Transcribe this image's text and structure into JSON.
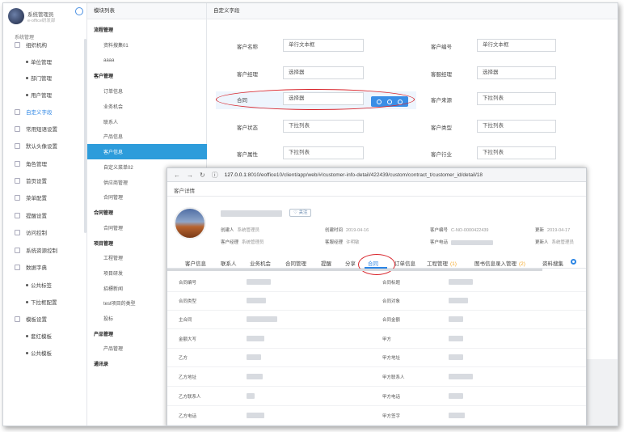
{
  "sidebar": {
    "user_name": "系统管理员",
    "user_sub": "e-office研发部",
    "section": "系统管理",
    "items": [
      {
        "label": "组织机构",
        "icon": "org-icon"
      },
      {
        "label": "单位管理",
        "sub": true
      },
      {
        "label": "部门管理",
        "sub": true
      },
      {
        "label": "用户管理",
        "sub": true
      },
      {
        "label": "自定义字段",
        "icon": "custom-field-icon",
        "active": true
      },
      {
        "label": "常用短语设置",
        "icon": "phrase-icon"
      },
      {
        "label": "默认头像设置",
        "icon": "avatar-setting-icon"
      },
      {
        "label": "角色管理",
        "icon": "role-icon"
      },
      {
        "label": "首页设置",
        "icon": "home-setting-icon"
      },
      {
        "label": "菜单配置",
        "icon": "menu-config-icon"
      },
      {
        "label": "提醒设置",
        "icon": "reminder-icon"
      },
      {
        "label": "访问控制",
        "icon": "access-icon"
      },
      {
        "label": "系统资源控制",
        "icon": "resource-icon"
      },
      {
        "label": "数据字典",
        "icon": "dictionary-icon"
      },
      {
        "label": "公共标签",
        "sub": true
      },
      {
        "label": "下拉框配置",
        "sub": true
      },
      {
        "label": "模板设置",
        "icon": "template-icon"
      },
      {
        "label": "套红模板",
        "sub": true
      },
      {
        "label": "公共模板",
        "sub": true
      }
    ]
  },
  "modules": {
    "title": "模块列表",
    "rows": [
      {
        "label": "流程管理",
        "group": true
      },
      {
        "label": "资料搜集01"
      },
      {
        "label": "aaaa"
      },
      {
        "label": "客户管理",
        "group": true
      },
      {
        "label": "订单信息"
      },
      {
        "label": "业务机会"
      },
      {
        "label": "联系人"
      },
      {
        "label": "产品信息"
      },
      {
        "label": "客户信息",
        "selected": true
      },
      {
        "label": "自定义菜单02"
      },
      {
        "label": "供应商管理"
      },
      {
        "label": "合同管理"
      },
      {
        "label": "合同管理",
        "group": true
      },
      {
        "label": "合同管理"
      },
      {
        "label": "项目管理",
        "group": true
      },
      {
        "label": "工程管理"
      },
      {
        "label": "项目研发"
      },
      {
        "label": "招標新闻"
      },
      {
        "label": "test项目的类型"
      },
      {
        "label": "投标"
      },
      {
        "label": "产品管理",
        "group": true
      },
      {
        "label": "产品管理"
      },
      {
        "label": "通讯录",
        "group": true
      }
    ]
  },
  "custom_fields": {
    "title": "自定义字段",
    "left": [
      {
        "label": "客户名称",
        "value": "单行文本框"
      },
      {
        "label": "客户经理",
        "value": "选择器"
      },
      {
        "label": "合同",
        "value": "选择器"
      },
      {
        "label": "客户状态",
        "value": "下拉列表"
      },
      {
        "label": "客户属性",
        "value": "下拉列表"
      }
    ],
    "right": [
      {
        "label": "客户编号",
        "value": "单行文本框"
      },
      {
        "label": "客服经理",
        "value": "选择器"
      },
      {
        "label": "客户来源",
        "value": "下拉列表"
      },
      {
        "label": "客户类型",
        "value": "下拉列表"
      },
      {
        "label": "客户行业",
        "value": "下拉列表"
      }
    ]
  },
  "browser": {
    "url_host": "127.0.0.1",
    "url_path": ":8010/eoffice10/client/app/web/#/customer-info-detail/422439/custom/contract_t/customer_id/detail/18",
    "page_title": "客户详情",
    "follow_label": "♡ 关注",
    "meta": {
      "creator_k": "创建人",
      "creator_v": "系统管理员",
      "ctime_k": "创建时间",
      "ctime_v": "2019-04-16",
      "code_k": "客户编号",
      "code_v": "C-NO-0000422439",
      "update_k": "更新",
      "update_v": "2019-04-17",
      "mgr_k": "客户经理",
      "mgr_v": "系统管理员",
      "svc_k": "客服经理",
      "svc_v": "许明敏",
      "phone_k": "客户电话",
      "upd_by_k": "更新人",
      "upd_by_v": "系统管理员"
    },
    "tabs": [
      {
        "label": "客户信息"
      },
      {
        "label": "联系人"
      },
      {
        "label": "业务机会"
      },
      {
        "label": "合同管理"
      },
      {
        "label": "提醒"
      },
      {
        "label": "分享"
      },
      {
        "label": "合同",
        "active": true
      },
      {
        "label": "订单信息"
      },
      {
        "label": "工程管理",
        "badge": "(1)"
      },
      {
        "label": "图书信息录入管理",
        "badge": "(2)"
      },
      {
        "label": "资料搜集"
      }
    ],
    "fields": [
      {
        "left": "合同编号",
        "right": "合同标题"
      },
      {
        "left": "合同类型",
        "right": "合同对象"
      },
      {
        "left": "主合同",
        "right": "合同金额"
      },
      {
        "left": "金额大写",
        "right": "甲方"
      },
      {
        "left": "乙方",
        "right": "甲方地址"
      },
      {
        "left": "乙方地址",
        "right": "甲方联系人"
      },
      {
        "left": "乙方联系人",
        "right": "甲方电话"
      },
      {
        "left": "乙方电话",
        "right": "甲方签字"
      }
    ]
  }
}
